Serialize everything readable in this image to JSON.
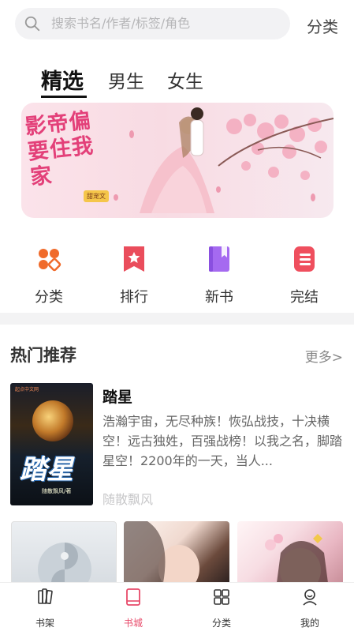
{
  "search": {
    "placeholder": "搜索书名/作者/标签/角色"
  },
  "header": {
    "category_label": "分类"
  },
  "tabs": [
    {
      "label": "精选",
      "active": true
    },
    {
      "label": "男生",
      "active": false
    },
    {
      "label": "女生",
      "active": false
    }
  ],
  "banner": {
    "title": "影帝偏要住我家",
    "badge": "甜宠文"
  },
  "quick_nav": [
    {
      "label": "分类",
      "icon": "category-grid-icon",
      "color": "#f06a2a"
    },
    {
      "label": "排行",
      "icon": "ranking-ribbon-icon",
      "color": "#ea4d5c"
    },
    {
      "label": "新书",
      "icon": "new-book-icon",
      "color": "#a56af0"
    },
    {
      "label": "完结",
      "icon": "finished-book-icon",
      "color": "#ef4f5e"
    }
  ],
  "section": {
    "title": "热门推荐",
    "more_label": "更多>"
  },
  "featured_book": {
    "title": "踏星",
    "description": "浩瀚宇宙，无尽种族！恢弘战技，十决横空！远古独姓，百强战榜！以我之名，脚踏星空！2200年的一天，当人...",
    "author": "随散飘风",
    "cover_title": "踏星",
    "cover_author_tag": "随散飘风/著",
    "cover_top_tag": "起点中文网"
  },
  "bottom_nav": [
    {
      "label": "书架",
      "icon": "bookshelf-icon",
      "active": false
    },
    {
      "label": "书城",
      "icon": "bookstore-icon",
      "active": true
    },
    {
      "label": "分类",
      "icon": "category-icon",
      "active": false
    },
    {
      "label": "我的",
      "icon": "profile-icon",
      "active": false
    }
  ],
  "colors": {
    "accent": "#e84a6a",
    "search_bg": "#f2f2f4",
    "divider": "#f3f3f4"
  }
}
